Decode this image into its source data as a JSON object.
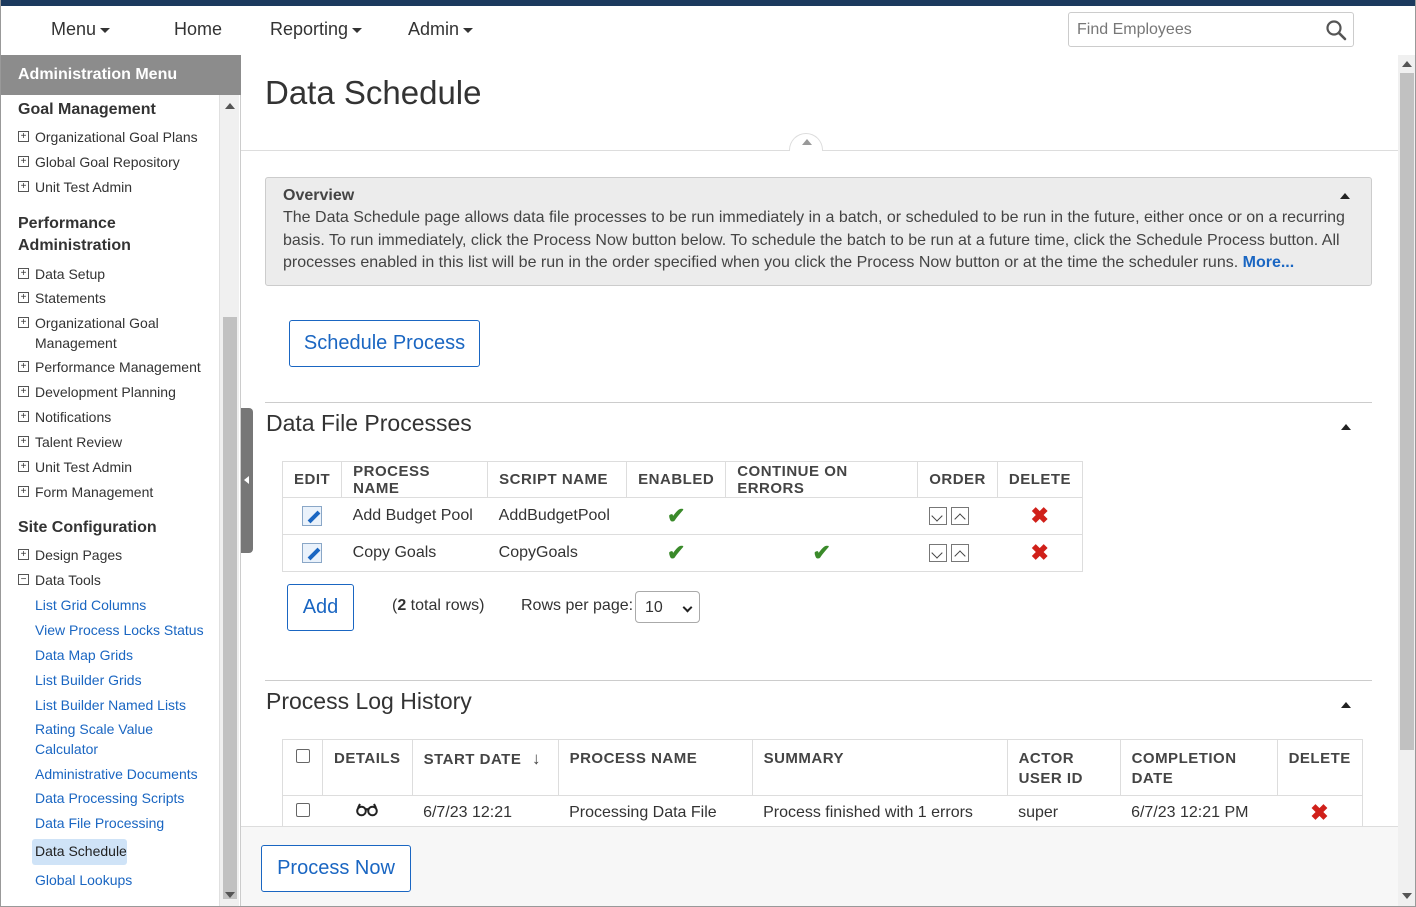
{
  "topnav": {
    "menu": "Menu",
    "home": "Home",
    "reporting": "Reporting",
    "admin": "Admin",
    "search_placeholder": "Find Employees"
  },
  "sidebar": {
    "header": "Administration Menu",
    "goal_section": "Goal Management",
    "goal_items": [
      "Organizational Goal Plans",
      "Global Goal Repository",
      "Unit Test Admin"
    ],
    "perf_section_1": "Performance",
    "perf_section_2": "Administration",
    "perf_items": [
      "Data Setup",
      "Statements",
      "Organizational Goal Management",
      "Performance Management",
      "Development Planning",
      "Notifications",
      "Talent Review",
      "Unit Test Admin",
      "Form Management"
    ],
    "site_section": "Site Configuration",
    "site_items": [
      "Design Pages",
      "Data Tools"
    ],
    "data_tools_links": [
      "List Grid Columns",
      "View Process Locks Status",
      "Data Map Grids",
      "List Builder Grids",
      "List Builder Named Lists",
      "Rating Scale Value Calculator",
      "Administrative Documents",
      "Data Processing Scripts",
      "Data File Processing"
    ],
    "active": "Data Schedule",
    "after_active": "Global Lookups"
  },
  "page": {
    "title": "Data Schedule"
  },
  "overview": {
    "title": "Overview",
    "text": "The Data Schedule page allows data file processes to be run immediately in a batch, or scheduled to be run in the future, either once or on a recurring basis. To run immediately, click the Process Now button below. To schedule the batch to be run at a future time, click the Schedule Process button. All processes enabled in this list will be run in the order specified when you click the Process Now button or at the time the scheduler runs.",
    "more": "More..."
  },
  "buttons": {
    "schedule_process": "Schedule Process",
    "add": "Add",
    "process_now": "Process Now"
  },
  "data_file_processes": {
    "title": "Data File Processes",
    "headers": [
      "EDIT",
      "PROCESS NAME",
      "SCRIPT NAME",
      "ENABLED",
      "CONTINUE ON ERRORS",
      "ORDER",
      "DELETE"
    ],
    "rows": [
      {
        "process_name": "Add Budget Pool",
        "script_name": "AddBudgetPool",
        "enabled": true,
        "continue_on_errors": false
      },
      {
        "process_name": "Copy Goals",
        "script_name": "CopyGoals",
        "enabled": true,
        "continue_on_errors": true
      }
    ],
    "total_prefix": "(",
    "total_count": "2",
    "total_suffix": " total rows)",
    "rows_per_page_label": "Rows per page:",
    "rows_per_page_value": "10"
  },
  "process_log_history": {
    "title": "Process Log History",
    "headers": {
      "details": "DETAILS",
      "start_date": "START DATE",
      "process_name": "PROCESS NAME",
      "summary": "SUMMARY",
      "actor_user_id_1": "ACTOR",
      "actor_user_id_2": "USER ID",
      "completion_date_1": "COMPLETION",
      "completion_date_2": "DATE",
      "delete": "DELETE"
    },
    "rows": [
      {
        "start_date": "6/7/23 12:21",
        "process_name": "Processing Data File",
        "summary": "Process finished with 1 errors",
        "actor": "super",
        "completion_date": "6/7/23 12:21 PM"
      }
    ]
  },
  "colors": {
    "accent": "#1a66c2",
    "check": "#3a8a2a",
    "delete": "#d0201a",
    "sidebar_header": "#8c8c8c"
  }
}
